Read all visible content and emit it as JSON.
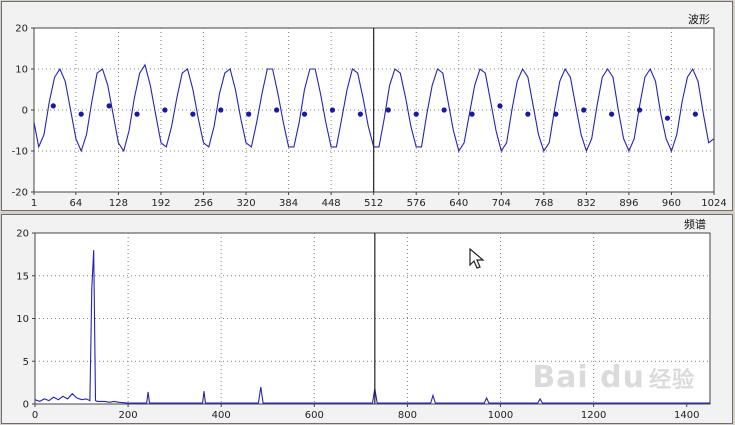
{
  "chart_data": [
    {
      "type": "line",
      "title": "波形",
      "xlabel": "",
      "ylabel": "",
      "xlim": [
        1,
        1024
      ],
      "ylim": [
        -20,
        20
      ],
      "xticks": [
        1,
        64,
        128,
        192,
        256,
        320,
        384,
        448,
        512,
        576,
        640,
        704,
        768,
        832,
        896,
        960,
        1024
      ],
      "yticks": [
        20,
        10,
        0,
        -10,
        -20
      ],
      "grid": true,
      "cursor_x": 512,
      "series": [
        {
          "color": "#2424b8",
          "x": [
            1,
            8,
            16,
            24,
            32,
            40,
            48,
            56,
            64,
            72,
            80,
            88,
            96,
            104,
            112,
            120,
            128,
            136,
            144,
            152,
            160,
            168,
            176,
            184,
            192,
            200,
            208,
            216,
            224,
            232,
            240,
            248,
            256,
            264,
            272,
            280,
            288,
            296,
            304,
            312,
            320,
            328,
            336,
            344,
            352,
            360,
            368,
            376,
            384,
            392,
            400,
            408,
            416,
            424,
            432,
            440,
            448,
            456,
            464,
            472,
            480,
            488,
            496,
            504,
            512,
            520,
            528,
            536,
            544,
            552,
            560,
            568,
            576,
            584,
            592,
            600,
            608,
            616,
            624,
            632,
            640,
            648,
            656,
            664,
            672,
            680,
            688,
            696,
            704,
            712,
            720,
            728,
            736,
            744,
            752,
            760,
            768,
            776,
            784,
            792,
            800,
            808,
            816,
            824,
            832,
            840,
            848,
            856,
            864,
            872,
            880,
            888,
            896,
            904,
            912,
            920,
            928,
            936,
            944,
            952,
            960,
            968,
            976,
            984,
            992,
            1000,
            1008,
            1016,
            1024
          ],
          "y": [
            -3,
            -9,
            -6,
            2,
            8,
            10,
            7,
            0,
            -7,
            -10,
            -6,
            2,
            9,
            10,
            6,
            -1,
            -8,
            -10,
            -5,
            3,
            9,
            11,
            6,
            -1,
            -8,
            -9,
            -4,
            3,
            9,
            10,
            5,
            -2,
            -8,
            -9,
            -4,
            4,
            9,
            10,
            5,
            -2,
            -8,
            -9,
            -3,
            4,
            10,
            10,
            4,
            -3,
            -9,
            -9,
            -3,
            5,
            10,
            10,
            4,
            -3,
            -9,
            -9,
            -2,
            5,
            10,
            9,
            3,
            -4,
            -9,
            -9,
            -2,
            6,
            10,
            9,
            3,
            -4,
            -9,
            -9,
            -1,
            6,
            10,
            9,
            2,
            -5,
            -10,
            -8,
            -1,
            6,
            10,
            9,
            2,
            -5,
            -10,
            -8,
            0,
            7,
            10,
            8,
            1,
            -6,
            -10,
            -8,
            0,
            7,
            10,
            8,
            1,
            -6,
            -10,
            -7,
            1,
            8,
            10,
            8,
            0,
            -7,
            -10,
            -7,
            1,
            8,
            10,
            7,
            -1,
            -7,
            -10,
            -6,
            2,
            8,
            10,
            7,
            -1,
            -8,
            -7
          ]
        },
        {
          "color": "#1a1a9e",
          "markers": true,
          "x": [
            30,
            72,
            114,
            156,
            198,
            240,
            282,
            324,
            366,
            408,
            450,
            492,
            534,
            576,
            618,
            660,
            702,
            744,
            786,
            828,
            870,
            912,
            954,
            996
          ],
          "y": [
            1,
            -1,
            1,
            -1,
            0,
            -1,
            0,
            -1,
            0,
            -1,
            0,
            -1,
            0,
            -1,
            0,
            -1,
            1,
            -1,
            -1,
            0,
            -1,
            0,
            -2,
            -1
          ]
        }
      ]
    },
    {
      "type": "line",
      "title": "频谱",
      "xlabel": "",
      "ylabel": "",
      "xlim": [
        0,
        1450
      ],
      "ylim": [
        0,
        20
      ],
      "xticks": [
        0,
        200,
        400,
        600,
        800,
        1000,
        1200,
        1400
      ],
      "yticks": [
        20,
        15,
        10,
        5,
        0
      ],
      "grid": true,
      "cursor_x": 730,
      "series": [
        {
          "color": "#2424b8",
          "x": [
            0,
            10,
            20,
            30,
            40,
            50,
            60,
            70,
            80,
            90,
            100,
            110,
            118,
            122,
            126,
            130,
            134,
            140,
            150,
            160,
            170,
            180,
            200,
            230,
            240,
            243,
            246,
            250,
            300,
            360,
            363,
            366,
            370,
            480,
            485,
            490,
            495,
            600,
            725,
            730,
            735,
            740,
            850,
            855,
            860,
            865,
            965,
            970,
            975,
            1080,
            1085,
            1090,
            1200,
            1450
          ],
          "y": [
            0.5,
            0.3,
            0.6,
            0.4,
            0.8,
            0.5,
            0.9,
            0.6,
            1.2,
            0.7,
            0.5,
            0.6,
            0.4,
            13.5,
            18,
            0.4,
            0.3,
            0.3,
            0.3,
            0.2,
            0.3,
            0.2,
            0.1,
            0.1,
            0.1,
            1.4,
            0.1,
            0.1,
            0.1,
            0.1,
            1.5,
            0.1,
            0.1,
            0.1,
            2,
            0.1,
            0.1,
            0.1,
            0.1,
            1.8,
            0.1,
            0.1,
            0.1,
            1,
            0.1,
            0.1,
            0.1,
            0.7,
            0.1,
            0.1,
            0.6,
            0.1,
            0.1,
            0.1
          ]
        }
      ]
    }
  ],
  "watermark": {
    "brand": "Bai du",
    "suffix": "经验"
  },
  "colors": {
    "background": "#d4d0c8",
    "plot": "#ffffff",
    "grid": "#808080",
    "cursor": "#222222"
  }
}
